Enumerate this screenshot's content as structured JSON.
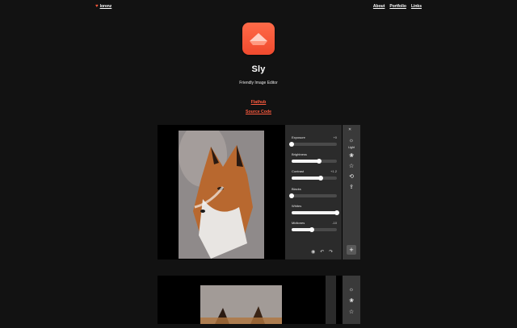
{
  "nav": {
    "brand": "lorenz",
    "links": [
      "About",
      "Portfolio",
      "Links"
    ]
  },
  "hero": {
    "title": "Sly",
    "subtitle": "Friendly Image Editor",
    "links": {
      "flathub": "Flathub",
      "source": "Source Code"
    }
  },
  "editor": {
    "adjustments": [
      {
        "label": "Exposure",
        "value": "+0",
        "level": 0.0
      },
      {
        "label": "Brightness",
        "value": "",
        "level": 0.6
      },
      {
        "label": "Contrast",
        "value": "+1.2",
        "level": 0.65
      },
      {
        "label": "Blacks",
        "value": "",
        "level": 0.0
      },
      {
        "label": "Whites",
        "value": "",
        "level": 1.0
      },
      {
        "label": "Midtones",
        "value": "-10",
        "level": 0.45
      }
    ],
    "side_label": "Light"
  },
  "colors": {
    "accent": "#ff5b3f",
    "panel": "#2b2b2b",
    "sidebar": "#3a3a3a"
  }
}
